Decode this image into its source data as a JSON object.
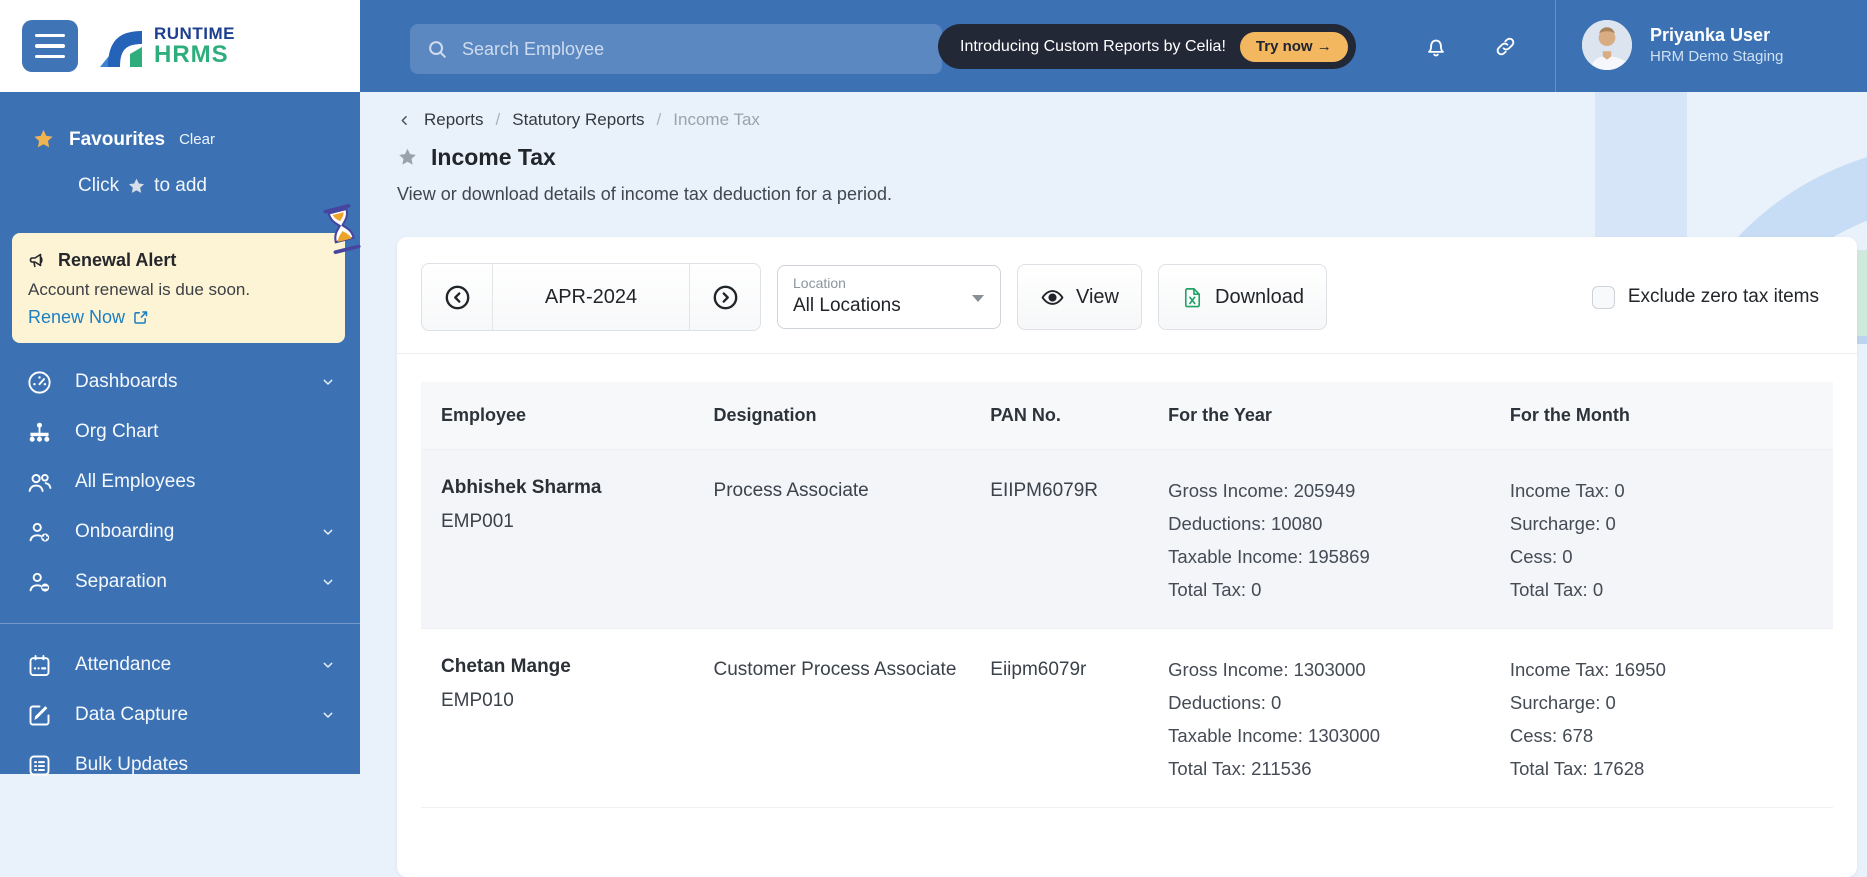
{
  "brand": {
    "line1": "RUNTIME",
    "line2": "HRMS"
  },
  "sidebar": {
    "favourites": {
      "title": "Favourites",
      "clear": "Clear",
      "hint_prefix": "Click",
      "hint_suffix": "to add"
    },
    "renewal": {
      "title": "Renewal Alert",
      "body": "Account renewal is due soon.",
      "link": "Renew Now"
    },
    "items": [
      {
        "label": "Dashboards",
        "icon": "gauge-icon"
      },
      {
        "label": "Org Chart",
        "icon": "org-chart-icon"
      },
      {
        "label": "All Employees",
        "icon": "people-icon"
      },
      {
        "label": "Onboarding",
        "icon": "person-plus-icon"
      },
      {
        "label": "Separation",
        "icon": "person-minus-icon"
      },
      {
        "label": "Attendance",
        "icon": "calendar-icon"
      },
      {
        "label": "Data Capture",
        "icon": "edit-icon"
      },
      {
        "label": "Bulk Updates",
        "icon": "checklist-icon"
      }
    ]
  },
  "header": {
    "search_placeholder": "Search Employee",
    "banner_text": "Introducing Custom Reports by Celia!",
    "banner_cta": "Try now →",
    "user_name": "Priyanka User",
    "user_org": "HRM Demo Staging"
  },
  "breadcrumb": {
    "items": [
      "Reports",
      "Statutory Reports",
      "Income Tax"
    ],
    "separator": "/"
  },
  "page": {
    "title": "Income Tax",
    "subtitle": "View or download details of income tax deduction for a period."
  },
  "toolbar": {
    "period": "APR-2024",
    "location_label": "Location",
    "location_value": "All Locations",
    "view_label": "View",
    "download_label": "Download",
    "exclude_label": "Exclude zero tax items",
    "exclude_checked": false
  },
  "table": {
    "columns": [
      "Employee",
      "Designation",
      "PAN No.",
      "For the Year",
      "For the Month"
    ],
    "rows": [
      {
        "name": "Abhishek Sharma",
        "code": "EMP001",
        "designation": "Process Associate",
        "pan": "EIIPM6079R",
        "year": [
          "Gross Income: 205949",
          "Deductions: 10080",
          "Taxable Income: 195869",
          "Total Tax: 0"
        ],
        "month": [
          "Income Tax: 0",
          "Surcharge: 0",
          "Cess: 0",
          "Total Tax: 0"
        ]
      },
      {
        "name": "Chetan Mange",
        "code": "EMP010",
        "designation": "Customer Process Associate",
        "pan": "Eiipm6079r",
        "year": [
          "Gross Income: 1303000",
          "Deductions: 0",
          "Taxable Income: 1303000",
          "Total Tax: 211536"
        ],
        "month": [
          "Income Tax: 16950",
          "Surcharge: 0",
          "Cess: 678",
          "Total Tax: 17628"
        ]
      }
    ]
  },
  "colors": {
    "accent_blue": "#3c72b4",
    "banner_dark": "#232837",
    "cta_orange": "#f3b760",
    "excel_green": "#21a366",
    "alert_bg": "#fdf3d5",
    "link_teal": "#1b7fc2",
    "favourite_star": "#f0b44f",
    "content_bg": "#e9f1fb"
  }
}
